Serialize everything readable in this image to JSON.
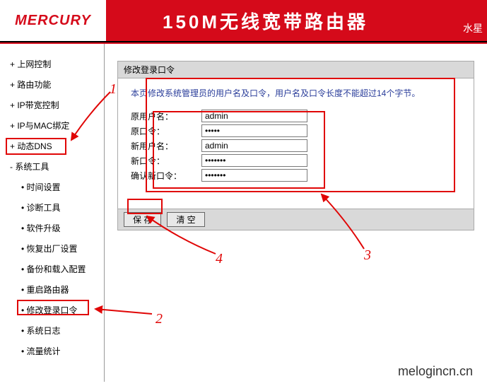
{
  "header": {
    "logo": "MERCURY",
    "title": "150M无线宽带路由器",
    "right": "水星"
  },
  "sidebar": {
    "items": [
      {
        "label": "上网控制",
        "type": "plus"
      },
      {
        "label": "路由功能",
        "type": "plus"
      },
      {
        "label": "IP带宽控制",
        "type": "plus"
      },
      {
        "label": "IP与MAC绑定",
        "type": "plus"
      },
      {
        "label": "动态DNS",
        "type": "plus"
      },
      {
        "label": "系统工具",
        "type": "minus"
      }
    ],
    "subs": [
      {
        "label": "时间设置"
      },
      {
        "label": "诊断工具"
      },
      {
        "label": "软件升级"
      },
      {
        "label": "恢复出厂设置"
      },
      {
        "label": "备份和载入配置"
      },
      {
        "label": "重启路由器"
      },
      {
        "label": "修改登录口令"
      },
      {
        "label": "系统日志"
      },
      {
        "label": "流量统计"
      }
    ]
  },
  "panel": {
    "title": "修改登录口令",
    "desc": "本页修改系统管理员的用户名及口令，用户名及口令长度不能超过14个字节。",
    "fields": {
      "old_user_label": "原用户名：",
      "old_user_value": "admin",
      "old_pass_label": "原口令：",
      "old_pass_value": "•••••",
      "new_user_label": "新用户名：",
      "new_user_value": "admin",
      "new_pass_label": "新口令：",
      "new_pass_value": "•••••••",
      "confirm_label": "确认新口令：",
      "confirm_value": "•••••••"
    },
    "buttons": {
      "save": "保 存",
      "clear": "清 空"
    }
  },
  "annotations": {
    "n1": "1",
    "n2": "2",
    "n3": "3",
    "n4": "4"
  },
  "watermark": "melogincn.cn"
}
